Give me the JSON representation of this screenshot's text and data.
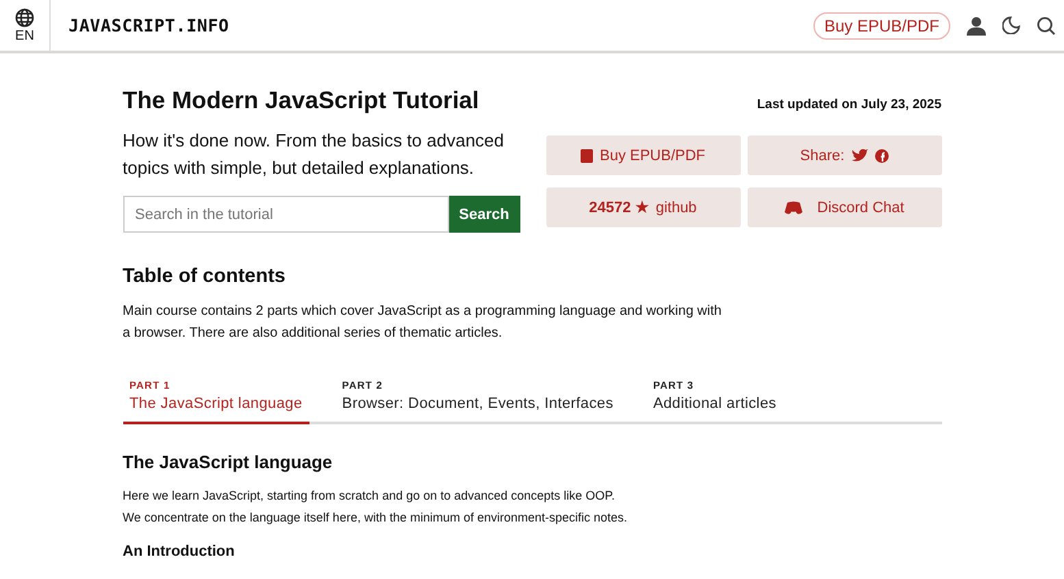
{
  "header": {
    "language": "EN",
    "logo": "JAVASCRIPT.INFO",
    "buy_button": "Buy EPUB/PDF"
  },
  "intro": {
    "title": "The Modern JavaScript Tutorial",
    "updated": "Last updated on July 23, 2025",
    "tagline": "How it's done now. From the basics to advanced topics with simple, but detailed explanations.",
    "search": {
      "placeholder": "Search in the tutorial",
      "button": "Search"
    },
    "actions": [
      {
        "kind": "buy",
        "label": "Buy EPUB/PDF"
      },
      {
        "kind": "share",
        "label": "Share:"
      },
      {
        "kind": "github",
        "count": "24572",
        "star": "★",
        "label": "github"
      },
      {
        "kind": "discord",
        "label": "Discord Chat"
      }
    ]
  },
  "toc": {
    "title": "Table of contents",
    "description": "Main course contains 2 parts which cover JavaScript as a programming language and working with a browser. There are also additional series of thematic articles.",
    "tabs": [
      {
        "part": "PART 1",
        "label": "The JavaScript language",
        "selected": true
      },
      {
        "part": "PART 2",
        "label": "Browser: Document, Events, Interfaces",
        "selected": false
      },
      {
        "part": "PART 3",
        "label": "Additional articles",
        "selected": false
      }
    ]
  },
  "section": {
    "title": "The JavaScript language",
    "paragraphs": [
      "Here we learn JavaScript, starting from scratch and go on to advanced concepts like OOP.",
      "We concentrate on the language itself here, with the minimum of environment-specific notes."
    ],
    "subheading": "An Introduction"
  }
}
